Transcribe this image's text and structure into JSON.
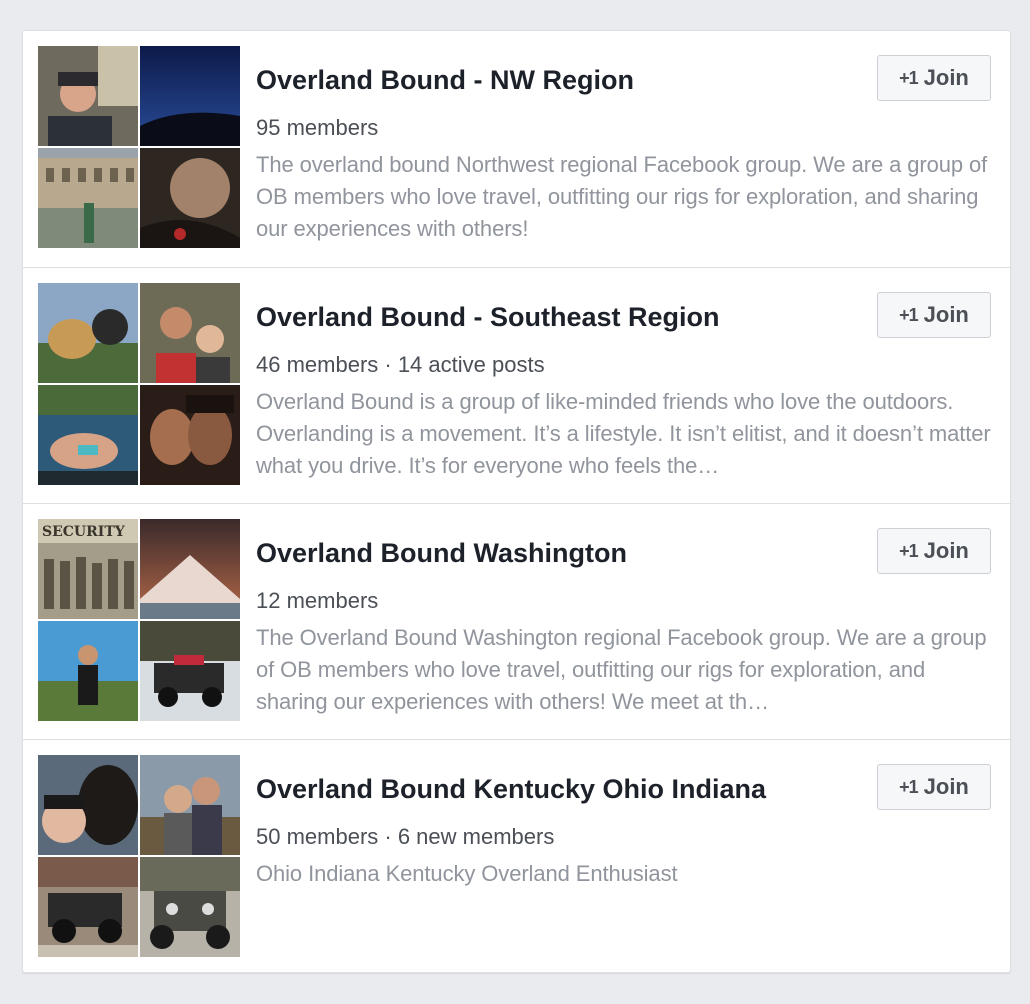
{
  "groups": [
    {
      "title": "Overland Bound - NW Region",
      "meta": "95 members",
      "description": "The overland bound Northwest regional Facebook group. We are a group of OB members who love travel, outfitting our rigs for exploration, and sharing our experiences with others!",
      "join_label": "Join",
      "join_icon": "+1",
      "photos": [
        "person-with-beanie-photo",
        "night-sky-photo",
        "colosseum-photo",
        "dark-interior-photo"
      ]
    },
    {
      "title": "Overland Bound - Southeast Region",
      "meta": "46 members · 14 active posts",
      "description": "Overland Bound is a group of like-minded friends who love the outdoors. Overlanding is a movement. It’s a lifestyle. It isn’t elitist, and it doesn’t matter what you drive. It’s for everyone who feels the…",
      "join_label": "Join",
      "join_icon": "+1",
      "photos": [
        "dog-and-person-photo",
        "couple-selfie-photo",
        "person-in-snow-photo",
        "couple-closeup-photo"
      ]
    },
    {
      "title": "Overland Bound Washington",
      "meta": "12 members",
      "description": "The Overland Bound Washington regional Facebook group. We are a group of OB members who love travel, outfitting our rigs for exploration, and sharing our experiences with others! We meet at th…",
      "join_label": "Join",
      "join_icon": "+1",
      "photos": [
        "vintage-security-photo",
        "mountain-sunset-photo",
        "runner-photo",
        "offroad-truck-snow-photo"
      ]
    },
    {
      "title": "Overland Bound Kentucky Ohio Indiana",
      "meta": "50 members · 6 new members",
      "description": "Ohio Indiana Kentucky Overland Enthusiast",
      "join_label": "Join",
      "join_icon": "+1",
      "photos": [
        "person-with-dog-photo",
        "couple-outdoors-photo",
        "jeep-photo",
        "jeep-front-photo"
      ]
    }
  ],
  "colors": {
    "background": "#e9ebee",
    "title": "#1d2129",
    "meta": "#4b4f56",
    "description": "#90949c",
    "border": "#dddfe2"
  }
}
